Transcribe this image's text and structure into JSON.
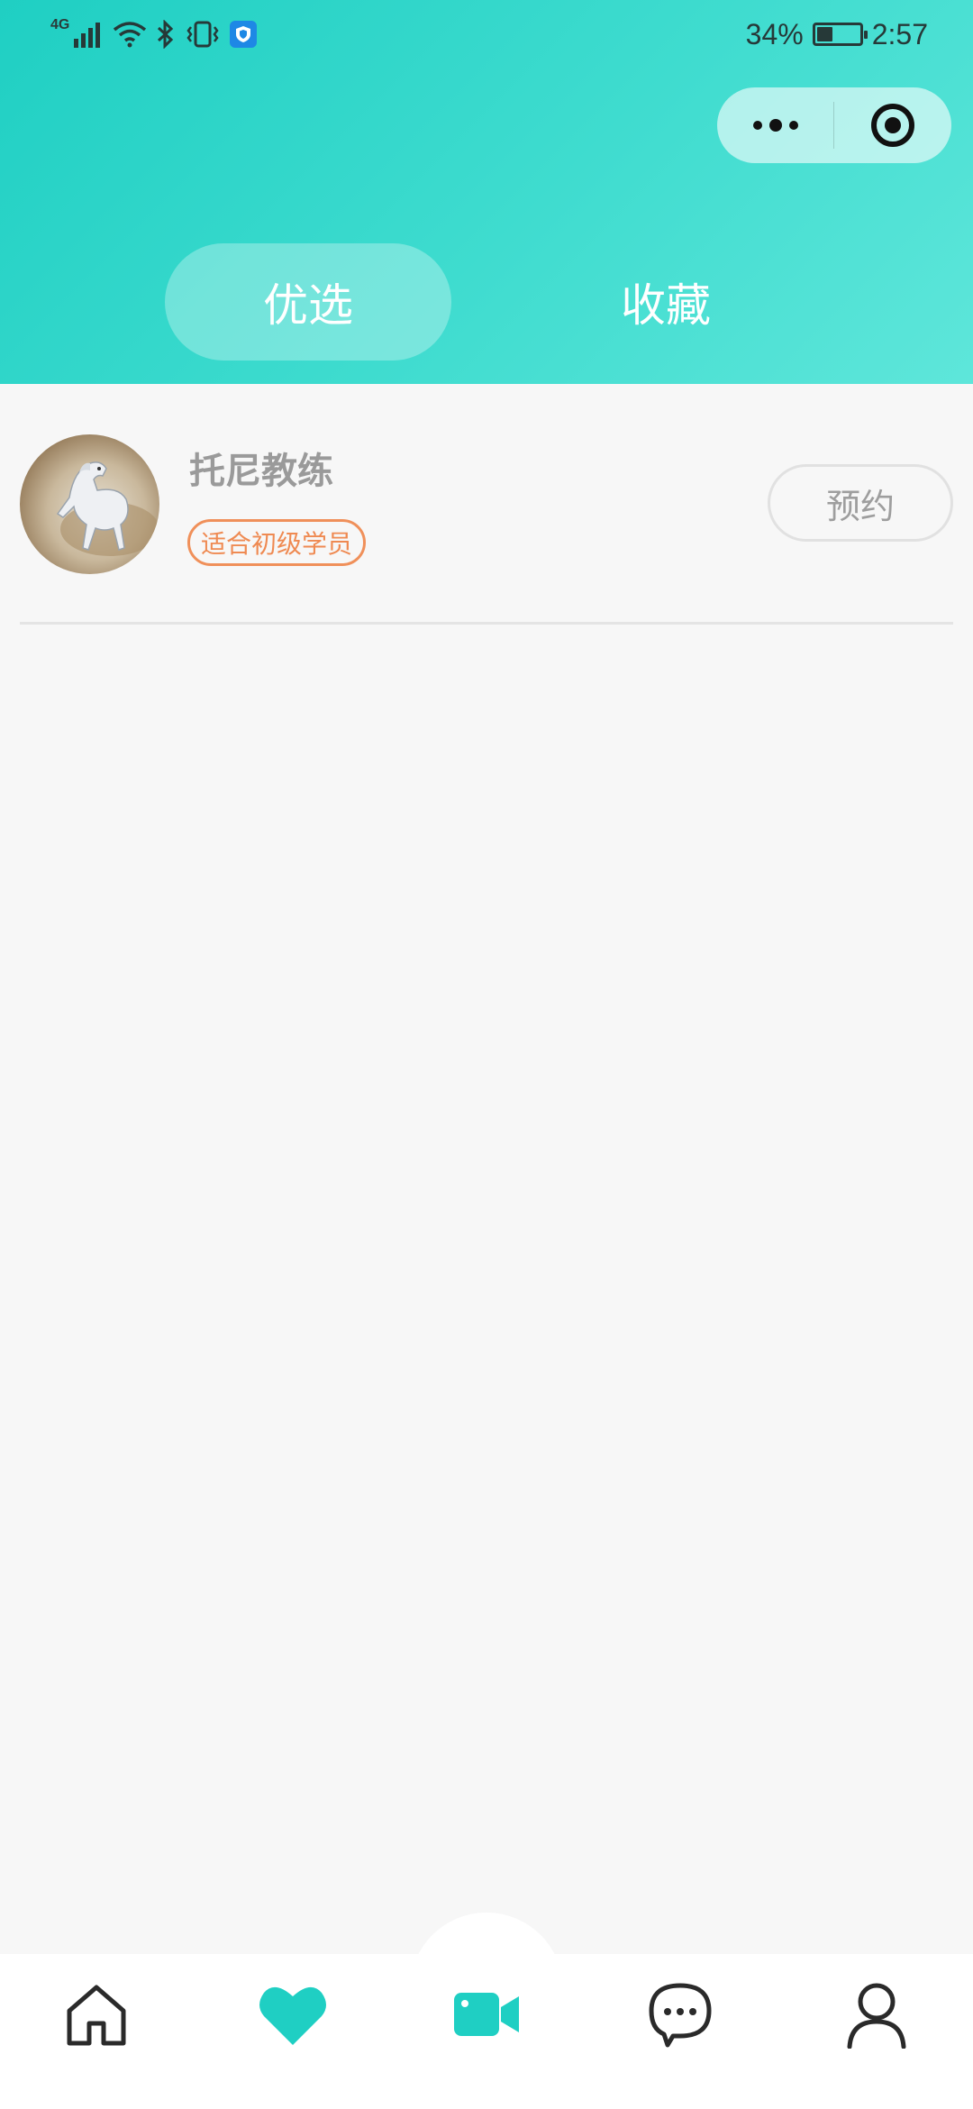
{
  "status_bar": {
    "network": "4G",
    "battery_percent": "34%",
    "battery_level": 0.34,
    "time": "2:57"
  },
  "capsule": {
    "more_icon": "more-dots-icon",
    "close_icon": "target-circle-icon"
  },
  "tabs": [
    {
      "label": "优选",
      "active": true
    },
    {
      "label": "收藏",
      "active": false
    }
  ],
  "coaches": [
    {
      "name": "托尼教练",
      "tag": "适合初级学员",
      "button_label": "预约",
      "avatar": "white-horse-image"
    }
  ],
  "bottom_nav": [
    {
      "icon": "home-icon",
      "active": false
    },
    {
      "icon": "heart-icon",
      "active": true
    },
    {
      "icon": "video-camera-icon",
      "active": false
    },
    {
      "icon": "chat-bubble-icon",
      "active": false
    },
    {
      "icon": "user-icon",
      "active": false
    }
  ],
  "colors": {
    "accent": "#1fcfc3",
    "tag": "#ef8a52"
  }
}
